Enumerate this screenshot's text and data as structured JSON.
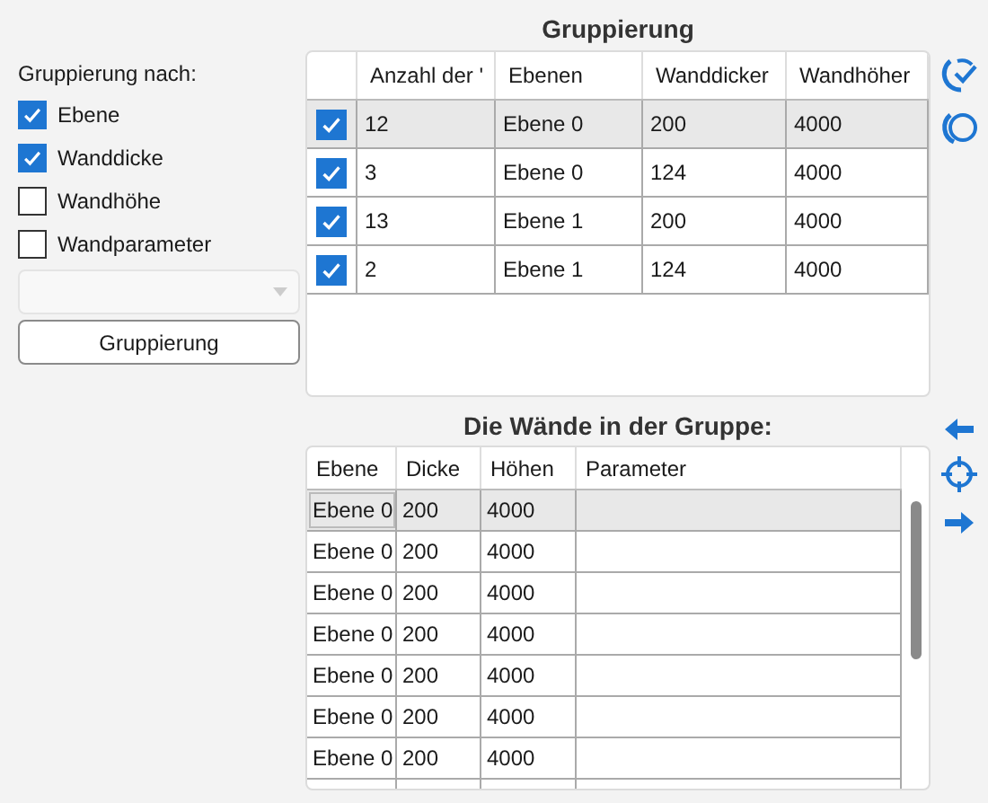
{
  "grouping_panel": {
    "label": "Gruppierung nach:",
    "options": [
      {
        "label": "Ebene",
        "checked": true
      },
      {
        "label": "Wanddicke",
        "checked": true
      },
      {
        "label": "Wandhöhe",
        "checked": false
      },
      {
        "label": "Wandparameter",
        "checked": false
      }
    ],
    "dropdown": {
      "disabled": true
    },
    "button": "Gruppierung"
  },
  "groups_table": {
    "title": "Gruppierung",
    "columns": [
      "Anzahl der '",
      "Ebenen",
      "Wanddicker",
      "Wandhöher"
    ],
    "rows": [
      {
        "checked": true,
        "selected": true,
        "cells": [
          "12",
          "Ebene 0",
          "200",
          "4000"
        ]
      },
      {
        "checked": true,
        "selected": false,
        "cells": [
          "3",
          "Ebene 0",
          "124",
          "4000"
        ]
      },
      {
        "checked": true,
        "selected": false,
        "cells": [
          "13",
          "Ebene 1",
          "200",
          "4000"
        ]
      },
      {
        "checked": true,
        "selected": false,
        "cells": [
          "2",
          "Ebene 1",
          "124",
          "4000"
        ]
      }
    ]
  },
  "walls_table": {
    "title": "Die Wände in der Gruppe:",
    "columns": [
      "Ebene",
      "Dicke",
      "Höhen",
      "Parameter"
    ],
    "rows": [
      {
        "selected": true,
        "cells": [
          "Ebene 0",
          "200",
          "4000",
          ""
        ]
      },
      {
        "selected": false,
        "cells": [
          "Ebene 0",
          "200",
          "4000",
          ""
        ]
      },
      {
        "selected": false,
        "cells": [
          "Ebene 0",
          "200",
          "4000",
          ""
        ]
      },
      {
        "selected": false,
        "cells": [
          "Ebene 0",
          "200",
          "4000",
          ""
        ]
      },
      {
        "selected": false,
        "cells": [
          "Ebene 0",
          "200",
          "4000",
          ""
        ]
      },
      {
        "selected": false,
        "cells": [
          "Ebene 0",
          "200",
          "4000",
          ""
        ]
      },
      {
        "selected": false,
        "cells": [
          "Ebene 0",
          "200",
          "4000",
          ""
        ]
      }
    ]
  }
}
